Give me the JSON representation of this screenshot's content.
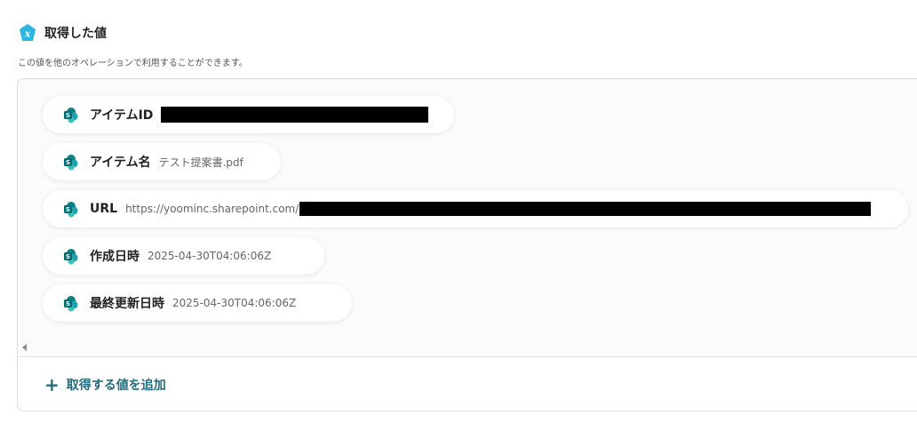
{
  "header": {
    "icon": "x-variable-icon",
    "title": "取得した値",
    "subtitle": "この値を他のオペレーションで利用することができます。"
  },
  "items": [
    {
      "label": "アイテムID",
      "value": "",
      "redacted": true
    },
    {
      "label": "アイテム名",
      "value": "テスト提案書.pdf",
      "redacted": false
    },
    {
      "label": "URL",
      "value": "https://yoominc.sharepoint.com/",
      "redacted": true
    },
    {
      "label": "作成日時",
      "value": "2025-04-30T04:06:06Z",
      "redacted": false
    },
    {
      "label": "最終更新日時",
      "value": "2025-04-30T04:06:06Z",
      "redacted": false
    }
  ],
  "add": {
    "icon": "plus-icon",
    "label": "取得する値を追加"
  },
  "colors": {
    "accent": "#226c7b",
    "badge": "#29b6e0",
    "sharepoint_teal": "#0b7f8b"
  }
}
